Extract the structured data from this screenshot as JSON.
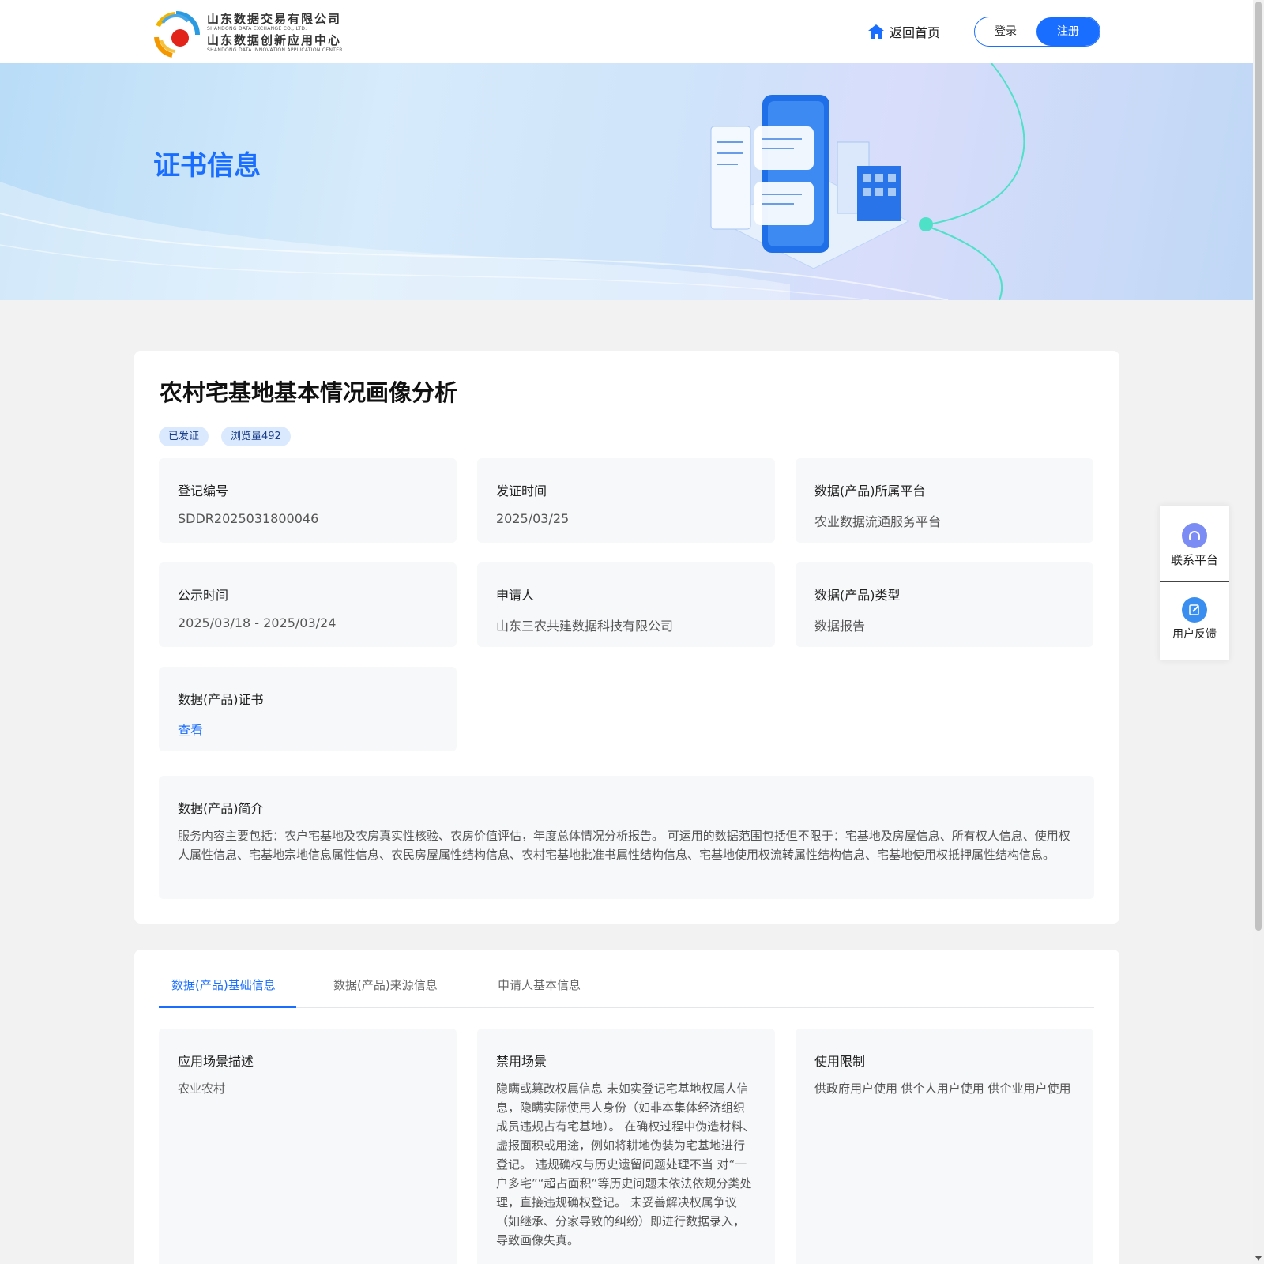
{
  "header": {
    "logo": {
      "company_cn": "山东数据交易有限公司",
      "company_en": "SHANDONG DATA EXCHANGE CO., LTD.",
      "center_cn": "山东数据创新应用中心",
      "center_en": "SHANDONG DATA INNOVATION APPLICATION CENTER"
    },
    "home_label": "返回首页",
    "login_label": "登录",
    "register_label": "注册",
    "accent_color": "#1a6eff"
  },
  "banner": {
    "title": "证书信息"
  },
  "product": {
    "title": "农村宅基地基本情况画像分析",
    "tags": [
      "已发证",
      "浏览量492"
    ],
    "fields": [
      {
        "label": "登记编号",
        "value": "SDDR2025031800046"
      },
      {
        "label": "发证时间",
        "value": "2025/03/25"
      },
      {
        "label": "数据(产品)所属平台",
        "value": "农业数据流通服务平台"
      },
      {
        "label": "公示时间",
        "value": "2025/03/18 - 2025/03/24"
      },
      {
        "label": "申请人",
        "value": "山东三农共建数据科技有限公司"
      },
      {
        "label": "数据(产品)类型",
        "value": "数据报告"
      },
      {
        "label": "数据(产品)证书",
        "value": "查看"
      }
    ],
    "intro": {
      "label": "数据(产品)简介",
      "text": "服务内容主要包括：农户宅基地及农房真实性核验、农房价值评估，年度总体情况分析报告。 可运用的数据范围包括但不限于：宅基地及房屋信息、所有权人信息、使用权人属性信息、宅基地宗地信息属性信息、农民房屋属性结构信息、农村宅基地批准书属性结构信息、宅基地使用权流转属性结构信息、宅基地使用权抵押属性结构信息。"
    }
  },
  "tabs": [
    {
      "label": "数据(产品)基础信息",
      "active": true
    },
    {
      "label": "数据(产品)来源信息",
      "active": false
    },
    {
      "label": "申请人基本信息",
      "active": false
    }
  ],
  "details": [
    {
      "label": "应用场景描述",
      "value": "农业农村"
    },
    {
      "label": "禁用场景",
      "value": "隐瞒或篡改权属信息 未如实登记宅基地权属人信息，隐瞒实际使用人身份（如非本集体经济组织成员违规占有宅基地）。 在确权过程中伪造材料、虚报面积或用途，例如将耕地伪装为宅基地进行登记。 违规确权与历史遗留问题处理不当 对“一户多宅”“超占面积”等历史问题未依法依规分类处理，直接违规确权登记。 未妥善解决权属争议（如继承、分家导致的纠纷）即进行数据录入，导致画像失真。"
    },
    {
      "label": "使用限制",
      "value": "供政府用户使用 供个人用户使用 供企业用户使用"
    }
  ],
  "side": {
    "contact_label": "联系平台",
    "feedback_label": "用户反馈",
    "icons": [
      "headset-icon",
      "edit-icon"
    ]
  }
}
